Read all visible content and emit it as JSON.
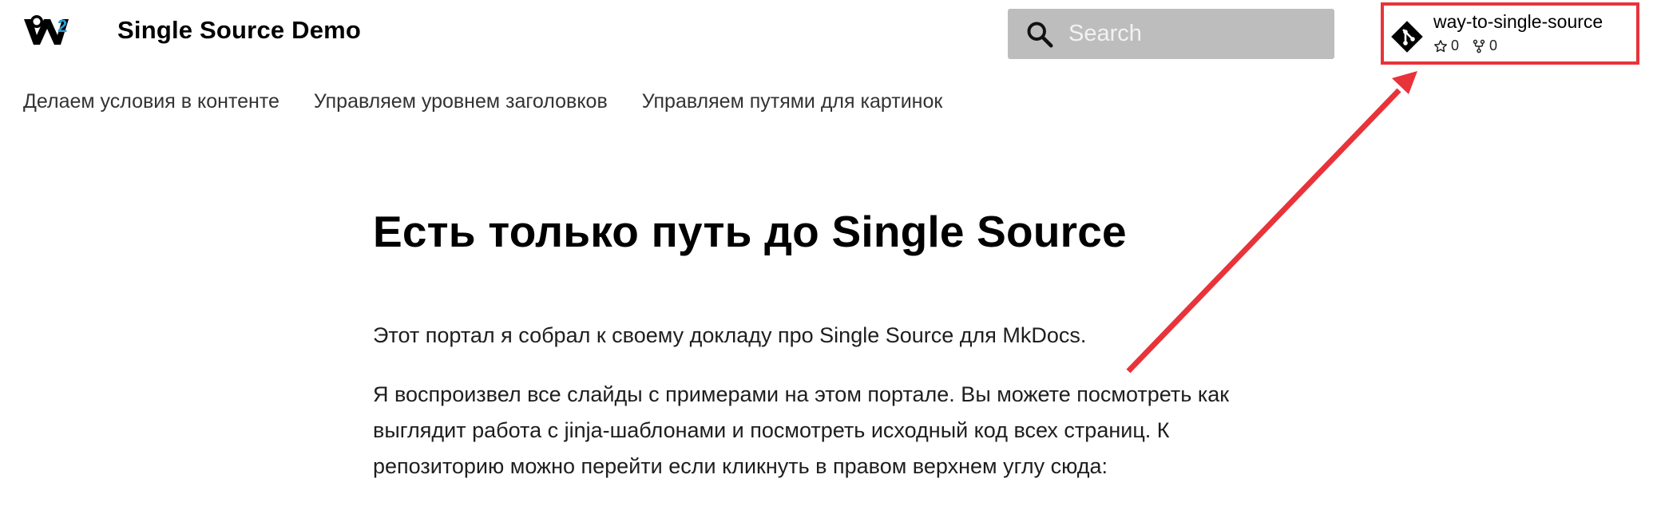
{
  "header": {
    "logo_icon": "material-w2-logo",
    "site_title": "Single Source Demo"
  },
  "search": {
    "icon": "search-icon",
    "placeholder": "Search"
  },
  "repo": {
    "icon": "git-icon",
    "name": "way-to-single-source",
    "stars": "0",
    "forks": "0",
    "highlight_color": "#e8333a"
  },
  "tabs": [
    {
      "label": "Делаем условия в контенте"
    },
    {
      "label": "Управляем уровнем заголовков"
    },
    {
      "label": "Управляем путями для картинок"
    }
  ],
  "main": {
    "title": "Есть только путь до Single Source",
    "paragraphs": [
      "Этот портал я собрал к своему докладу про Single Source для MkDocs.",
      "Я воспроизвел все слайды с примерами на этом портале. Вы можете посмотреть как выглядит работа с jinja-шаблонами и посмотреть исходный код всех страниц. К репозиторию можно перейти если кликнуть в правом верхнем углу сюда:"
    ]
  },
  "colors": {
    "search_bg": "#bdbdbd",
    "annotation_red": "#e8333a",
    "logo_accent": "#2e9ad0"
  }
}
